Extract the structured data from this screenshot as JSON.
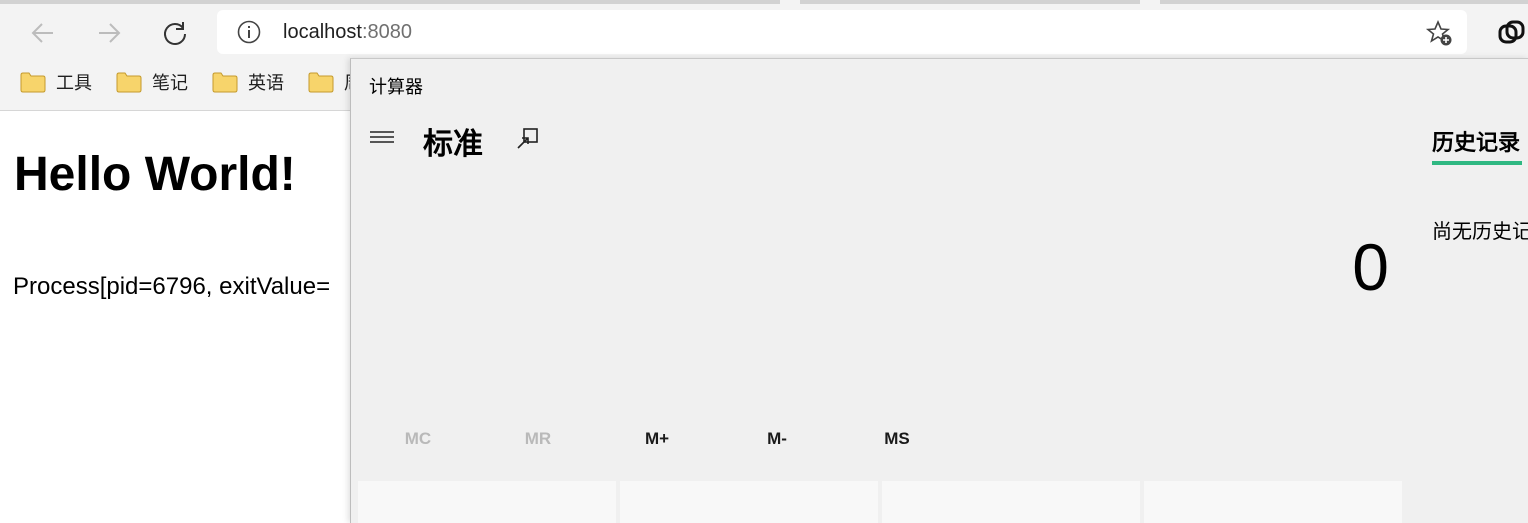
{
  "browser": {
    "address": {
      "host": "localhost",
      "port": ":8080"
    },
    "bookmarks": [
      {
        "label": "工具"
      },
      {
        "label": "笔记"
      },
      {
        "label": "英语"
      },
      {
        "label": "周"
      }
    ]
  },
  "page": {
    "heading": "Hello World!",
    "process_text": "Process[pid=6796, exitValue="
  },
  "calculator": {
    "title": "计算器",
    "mode": "标准",
    "display": "0",
    "memory": [
      {
        "label": "MC",
        "enabled": false
      },
      {
        "label": "MR",
        "enabled": false
      },
      {
        "label": "M+",
        "enabled": true
      },
      {
        "label": "M-",
        "enabled": true
      },
      {
        "label": "MS",
        "enabled": true
      }
    ],
    "history": {
      "title": "历史记录",
      "empty": "尚无历史记录"
    },
    "colors": {
      "accent": "#2fb882"
    }
  }
}
